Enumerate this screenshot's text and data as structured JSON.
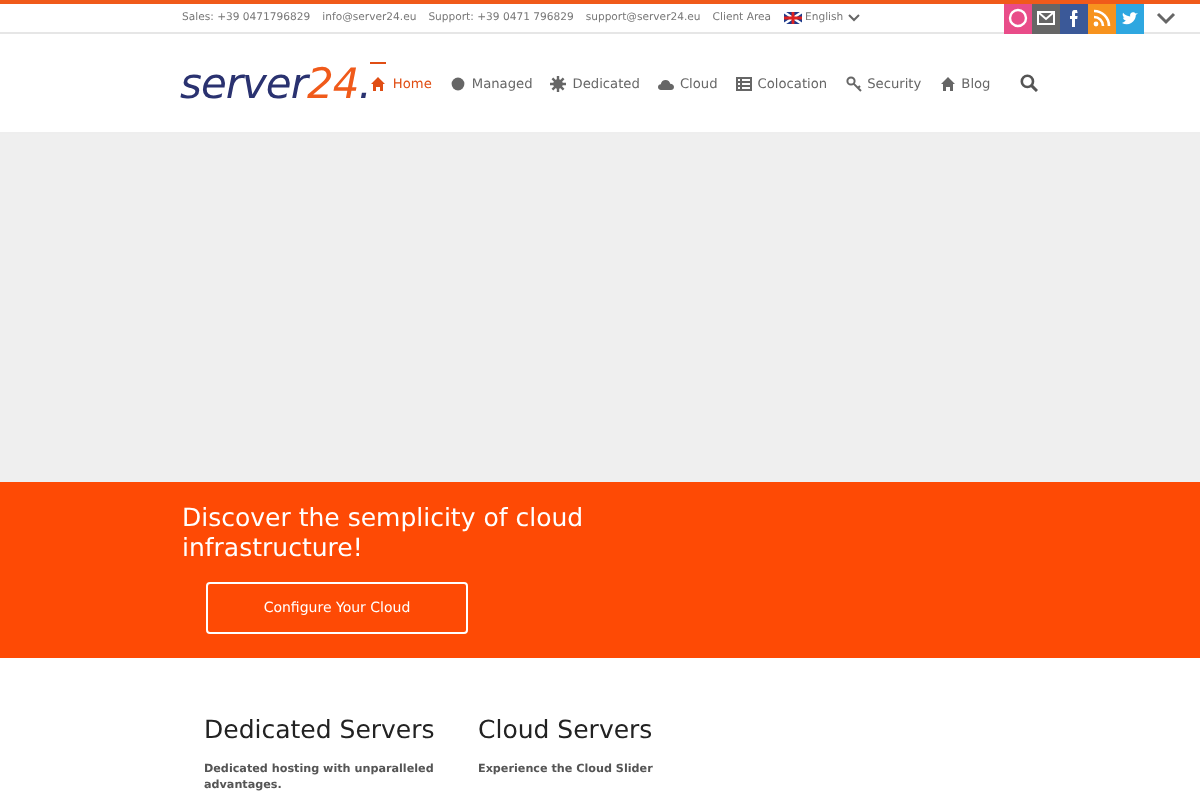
{
  "top_bar": {
    "contacts": [
      "Sales: +39 0471796829",
      "info@server24.eu",
      "Support: +39 0471 796829",
      "support@server24.eu",
      "Client Area"
    ],
    "language": "English",
    "social": [
      {
        "kind": "dribbble",
        "color": "#e94c89"
      },
      {
        "kind": "mail",
        "color": "#666666"
      },
      {
        "kind": "facebook",
        "color": "#3b5998"
      },
      {
        "kind": "rss",
        "color": "#f7931e"
      },
      {
        "kind": "twitter",
        "color": "#2ea7e0"
      }
    ]
  },
  "logo": {
    "word": "server",
    "number": "24",
    "dot": "."
  },
  "nav": [
    {
      "label": "Home",
      "selected": true
    },
    {
      "label": "Managed",
      "selected": false
    },
    {
      "label": "Dedicated",
      "selected": false
    },
    {
      "label": "Cloud",
      "selected": false
    },
    {
      "label": "Colocation",
      "selected": false
    },
    {
      "label": "Security",
      "selected": false
    },
    {
      "label": "Blog",
      "selected": false
    }
  ],
  "cta": {
    "heading": "Discover the semplicity of cloud infrastructure!",
    "button": "Configure Your Cloud"
  },
  "features": [
    {
      "title": "Dedicated Servers",
      "text": "Dedicated hosting with unparalleled advantages."
    },
    {
      "title": "Cloud Servers",
      "text": "Experience the Cloud Slider"
    }
  ]
}
